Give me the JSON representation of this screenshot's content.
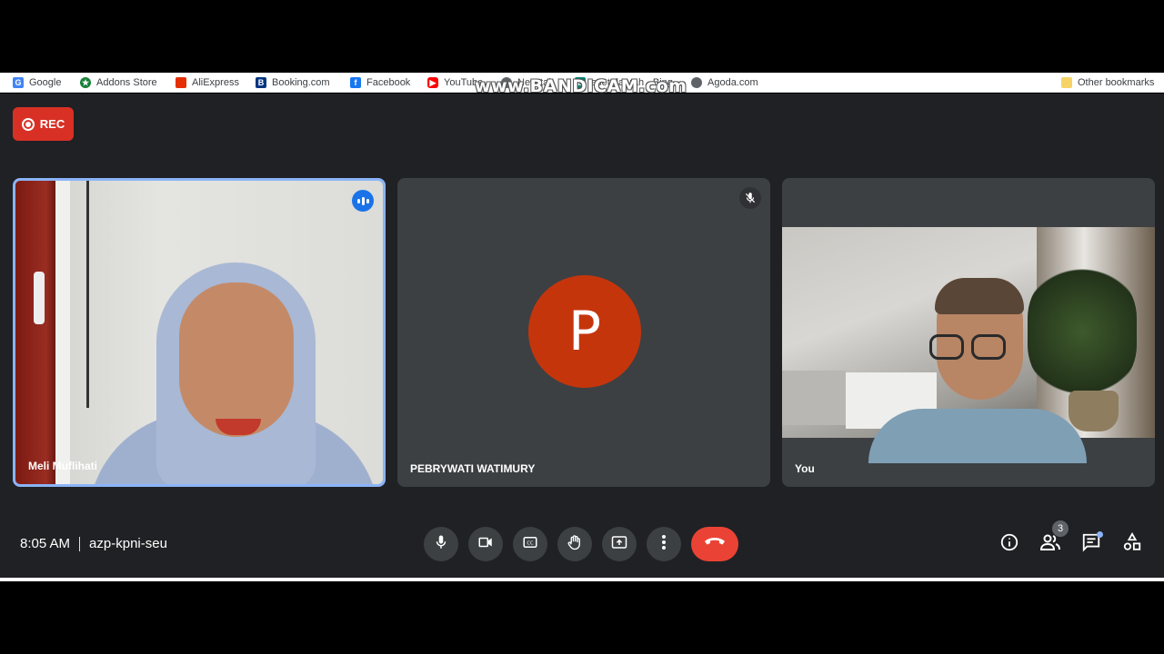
{
  "bookmarks": [
    {
      "label": "Google",
      "icon": "google-icon",
      "color": "#4285f4"
    },
    {
      "label": "Addons Store",
      "icon": "addons-store-icon",
      "color": "#188038"
    },
    {
      "label": "AliExpress",
      "icon": "aliexpress-icon",
      "color": "#e62e04"
    },
    {
      "label": "Booking.com",
      "icon": "booking-icon",
      "color": "#003580"
    },
    {
      "label": "Facebook",
      "icon": "facebook-icon",
      "color": "#1877f2"
    },
    {
      "label": "YouTube",
      "icon": "youtube-icon",
      "color": "#ff0000"
    },
    {
      "label": "New tab",
      "icon": "globe-icon",
      "color": "#5f6368"
    },
    {
      "label": "aset daerah - Bing",
      "icon": "bing-icon",
      "color": "#008373"
    },
    {
      "label": "Agoda.com",
      "icon": "globe-icon",
      "color": "#5f6368"
    }
  ],
  "other_bookmarks": "Other bookmarks",
  "watermark": "www.BANDICAM.com",
  "recording": {
    "label": "REC",
    "color": "#d93025"
  },
  "participants": [
    {
      "name": "Meli Muflihati",
      "speaking": true
    },
    {
      "name": "PEBRYWATI WATIMURY",
      "avatar_letter": "P",
      "muted": true,
      "avatar_color": "#c5350c"
    },
    {
      "name": "You"
    }
  ],
  "meeting": {
    "time": "8:05 AM",
    "code": "azp-kpni-seu"
  },
  "controls": [
    "microphone-icon",
    "camera-icon",
    "captions-icon",
    "raise-hand-icon",
    "present-icon",
    "more-options-icon",
    "leave-call-icon"
  ],
  "side_controls": {
    "people_count": "3"
  },
  "colors": {
    "stage": "#202124",
    "tile": "#3c4043",
    "leave": "#ea4335",
    "active_border": "#8ab4f8"
  }
}
